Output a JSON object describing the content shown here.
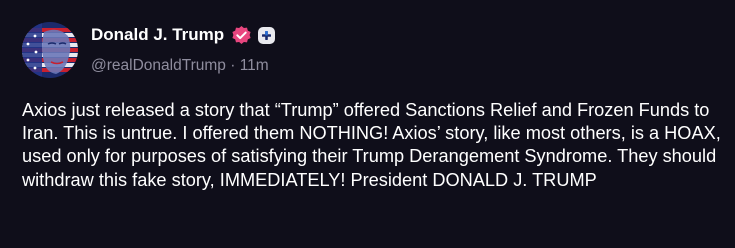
{
  "post": {
    "author_name": "Donald J. Trump",
    "handle": "@realDonaldTrump",
    "separator": "·",
    "time_ago": "11m",
    "body": "Axios just released a story that “Trump” offered Sanctions Relief and Frozen Funds to Iran. This is untrue. I offered them NOTHING! Axios’ story, like most others, is a HOAX, used only for purposes of satisfying their Trump Derangement Syndrome. They should withdraw this fake story, IMMEDIATELY! President DONALD J. TRUMP"
  },
  "badges": {
    "verified_icon": "verified-check-icon",
    "plus_icon": "plus-icon"
  },
  "colors": {
    "background": "#0f0e1a",
    "text": "#ffffff",
    "muted": "#8f8d9e",
    "verified": "#e8467f"
  }
}
